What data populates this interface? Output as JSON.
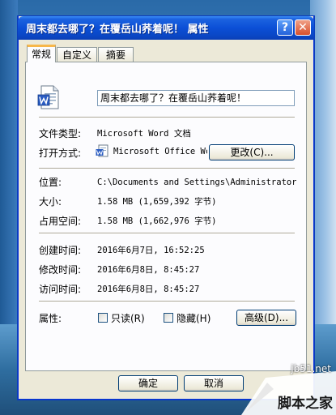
{
  "window": {
    "title": "周末都去哪了？在覆岳山荞着呢！ 属性",
    "help_symbol": "?",
    "close_symbol": "✕"
  },
  "tabs": [
    {
      "label": "常规",
      "active": true
    },
    {
      "label": "自定义",
      "active": false
    },
    {
      "label": "摘要",
      "active": false
    }
  ],
  "general": {
    "file_name": "周末都去哪了？在覆岳山荞着呢！",
    "file_type_label": "文件类型:",
    "file_type_value": "Microsoft Word 文档",
    "open_with_label": "打开方式:",
    "open_with_value": "Microsoft Office Wc",
    "change_button": "更改(C)...",
    "location_label": "位置:",
    "location_value": "C:\\Documents and Settings\\Administrator\\桌",
    "size_label": "大小:",
    "size_value": "1.58 MB (1,659,392 字节)",
    "size_on_disk_label": "占用空间:",
    "size_on_disk_value": "1.58 MB (1,662,976 字节)",
    "created_label": "创建时间:",
    "created_value": "2016年6月7日, 16:52:25",
    "modified_label": "修改时间:",
    "modified_value": "2016年6月8日, 8:45:27",
    "accessed_label": "访问时间:",
    "accessed_value": "2016年6月8日, 8:45:27",
    "attributes_label": "属性:",
    "readonly_label": "只读(R)",
    "readonly_checked": false,
    "hidden_label": "隐藏(H)",
    "hidden_checked": false,
    "advanced_button": "高级(D)..."
  },
  "footer": {
    "ok_button": "确定",
    "cancel_button": "取消"
  },
  "watermark": {
    "site": "jb51.net",
    "name": "脚本之家"
  },
  "colors": {
    "titlebar": "#0b4fd6",
    "dialog_bg": "#ece9d8",
    "tab_highlight": "#f7b74b"
  },
  "icons": {
    "file_icon": "word-document-icon",
    "open_with_icon": "word-app-icon"
  }
}
